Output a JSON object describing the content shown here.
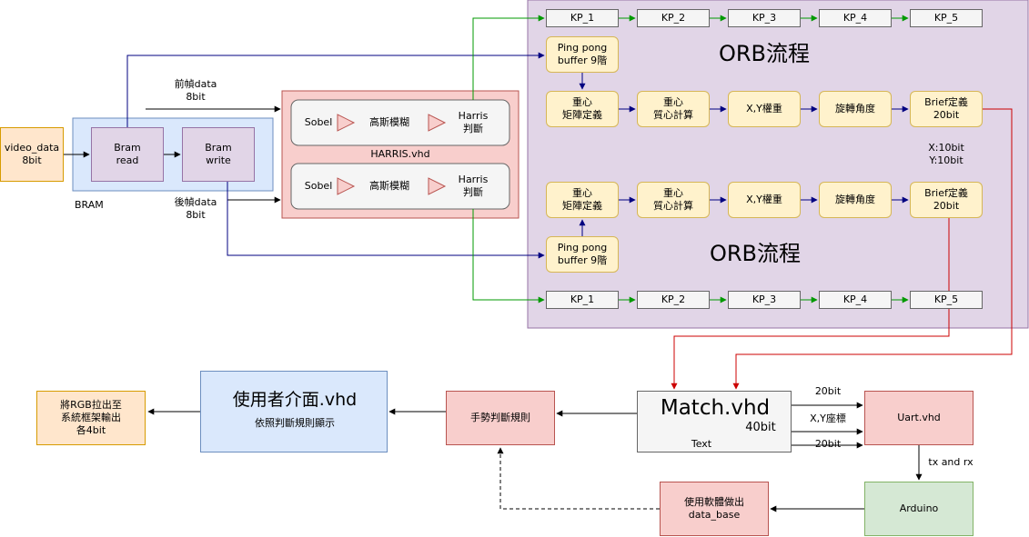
{
  "video_data": "video_data\n8bit",
  "bram": {
    "label": "BRAM",
    "read": "Bram\nread",
    "write": "Bram\nwrite"
  },
  "edge_labels": {
    "prev_frame": "前幀data\n8bit",
    "next_frame": "後幀data\n8bit",
    "xy_bits": "X:10bit\nY:10bit",
    "bits_20_top": "20bit",
    "xy_coord": "X,Y座標",
    "bits_20_bottom": "20bit",
    "tx_rx": "tx and rx"
  },
  "harris": {
    "label": "HARRIS.vhd",
    "row1": {
      "sobel": "Sobel",
      "gauss": "高斯模糊",
      "harris": "Harris\n判斷"
    },
    "row2": {
      "sobel": "Sobel",
      "gauss": "高斯模糊",
      "harris": "Harris\n判斷"
    }
  },
  "orb": {
    "title_top": "ORB流程",
    "title_bottom": "ORB流程",
    "kp_top": [
      "KP_1",
      "KP_2",
      "KP_3",
      "KP_4",
      "KP_5"
    ],
    "kp_bottom": [
      "KP_1",
      "KP_2",
      "KP_3",
      "KP_4",
      "KP_5"
    ],
    "pingpong_top": "Ping pong\nbuffer 9階",
    "pingpong_bottom": "Ping pong\nbuffer 9階",
    "steps_top": [
      "重心\n矩陣定義",
      "重心\n質心計算",
      "X,Y權重",
      "旋轉角度",
      "Brief定義\n20bit"
    ],
    "steps_bottom": [
      "重心\n矩陣定義",
      "重心\n質心計算",
      "X,Y權重",
      "旋轉角度",
      "Brief定義\n20bit"
    ]
  },
  "match": {
    "title": "Match.vhd",
    "bits": "40bit",
    "text": "Text"
  },
  "uart": "Uart.vhd",
  "arduino": "Arduino",
  "database": "使用軟體做出\ndata_base",
  "gesture": "手勢判斷規則",
  "ui": {
    "title": "使用者介面.vhd",
    "subtitle": "依照判斷規則顯示"
  },
  "rgb_out": "將RGB拉出至\n系統框架輸出\n各4bit",
  "colors": {
    "green_line": "#009900",
    "navy_line": "#000080",
    "red_line": "#cc0000"
  }
}
